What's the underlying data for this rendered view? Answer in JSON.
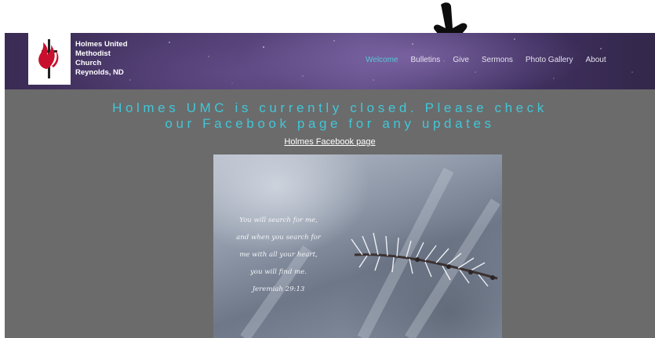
{
  "annotation": {
    "icon": "hand-drawn-arrow-down-icon",
    "color": "#111111"
  },
  "site": {
    "background": "#6b6b6b",
    "logo": {
      "icon": "united-methodist-cross-flame-logo"
    },
    "brand": {
      "lines": [
        "Holmes United",
        "Methodist",
        "Church",
        "Reynolds, ND"
      ]
    },
    "nav": {
      "items": [
        "Welcome",
        "Bulletins",
        "Give",
        "Sermons",
        "Photo Gallery",
        "About"
      ],
      "active": "Welcome",
      "active_color": "#58c7d6"
    },
    "headline": {
      "line1": "Holmes UMC is currently closed.  Please check",
      "line2": "our Facebook page for any updates",
      "color": "#42c6d8"
    },
    "facebook_link": "Holmes Facebook page",
    "image": {
      "verse_lines": [
        "You will search for me,",
        "and when you search for",
        "me with all your heart,",
        "you will find me.",
        "Jeremiah 29:13"
      ]
    }
  }
}
